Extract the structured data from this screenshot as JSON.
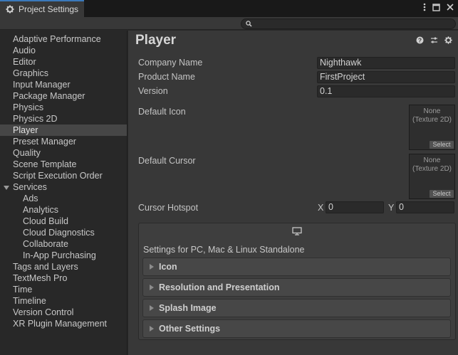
{
  "window": {
    "tab_title": "Project Settings",
    "menu_icon": "kebab-menu-icon",
    "maximize_icon": "maximize-icon",
    "close_icon": "close-icon"
  },
  "search": {
    "placeholder": "",
    "value": ""
  },
  "sidebar": {
    "items": [
      {
        "label": "Adaptive Performance"
      },
      {
        "label": "Audio"
      },
      {
        "label": "Editor"
      },
      {
        "label": "Graphics"
      },
      {
        "label": "Input Manager"
      },
      {
        "label": "Package Manager"
      },
      {
        "label": "Physics"
      },
      {
        "label": "Physics 2D"
      },
      {
        "label": "Player"
      },
      {
        "label": "Preset Manager"
      },
      {
        "label": "Quality"
      },
      {
        "label": "Scene Template"
      },
      {
        "label": "Script Execution Order"
      },
      {
        "label": "Services"
      },
      {
        "label": "Ads"
      },
      {
        "label": "Analytics"
      },
      {
        "label": "Cloud Build"
      },
      {
        "label": "Cloud Diagnostics"
      },
      {
        "label": "Collaborate"
      },
      {
        "label": "In-App Purchasing"
      },
      {
        "label": "Tags and Layers"
      },
      {
        "label": "TextMesh Pro"
      },
      {
        "label": "Time"
      },
      {
        "label": "Timeline"
      },
      {
        "label": "Version Control"
      },
      {
        "label": "XR Plugin Management"
      }
    ],
    "selected": "Player"
  },
  "main": {
    "title": "Player",
    "company_label": "Company Name",
    "company_value": "Nighthawk",
    "product_label": "Product Name",
    "product_value": "FirstProject",
    "version_label": "Version",
    "version_value": "0.1",
    "default_icon_label": "Default Icon",
    "default_cursor_label": "Default Cursor",
    "texture_none": "None",
    "texture_type": "(Texture 2D)",
    "select_label": "Select",
    "hotspot_label": "Cursor Hotspot",
    "hotspot_x_label": "X",
    "hotspot_x": "0",
    "hotspot_y_label": "Y",
    "hotspot_y": "0",
    "platform_label": "Settings for PC, Mac & Linux Standalone",
    "sections": [
      {
        "label": "Icon"
      },
      {
        "label": "Resolution and Presentation"
      },
      {
        "label": "Splash Image"
      },
      {
        "label": "Other Settings"
      }
    ]
  },
  "colors": {
    "accent": "#3a79bb",
    "background": "#383838",
    "sidebar_bg": "#282828",
    "selected_bg": "#464646"
  }
}
